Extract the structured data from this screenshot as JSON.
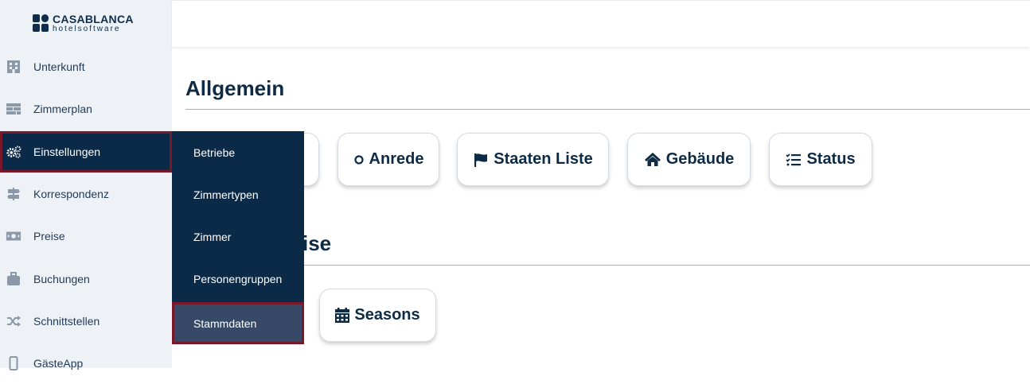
{
  "logo": {
    "name": "CASABLANCA",
    "sub": "hotelsoftware"
  },
  "sidebar": {
    "items": [
      {
        "label": "Unterkunft",
        "icon": "building-icon"
      },
      {
        "label": "Zimmerplan",
        "icon": "grid-plan-icon"
      },
      {
        "label": "Einstellungen",
        "icon": "gears-icon"
      },
      {
        "label": "Korrespondenz",
        "icon": "signpost-icon"
      },
      {
        "label": "Preise",
        "icon": "money-bill-icon"
      },
      {
        "label": "Buchungen",
        "icon": "suitcase-icon"
      },
      {
        "label": "Schnittstellen",
        "icon": "shuffle-icon"
      },
      {
        "label": "GästeApp",
        "icon": "mobile-icon"
      }
    ],
    "active_item": "Einstellungen"
  },
  "submenu": {
    "items": [
      "Betriebe",
      "Zimmertypen",
      "Zimmer",
      "Personengruppen",
      "Stammdaten"
    ],
    "active_item": "Stammdaten"
  },
  "main": {
    "section1": {
      "title": "Allgemein",
      "cards": [
        {
          "label": "Anrede",
          "icon": "circle-outline-icon"
        },
        {
          "label": "Staaten Liste",
          "icon": "flag-icon"
        },
        {
          "label": "Gebäude",
          "icon": "home-icon"
        },
        {
          "label": "Status",
          "icon": "checklist-icon"
        }
      ]
    },
    "section2": {
      "title_visible": "ise",
      "cards": [
        {
          "label": "Seasons",
          "icon": "calendar-icon"
        }
      ]
    }
  },
  "colors": {
    "sidebar_bg": "#eef2f7",
    "navy": "#0a2a47",
    "highlight_border": "#7a1728",
    "submenu_active": "#364a68",
    "text_dark": "#0d2b45"
  }
}
